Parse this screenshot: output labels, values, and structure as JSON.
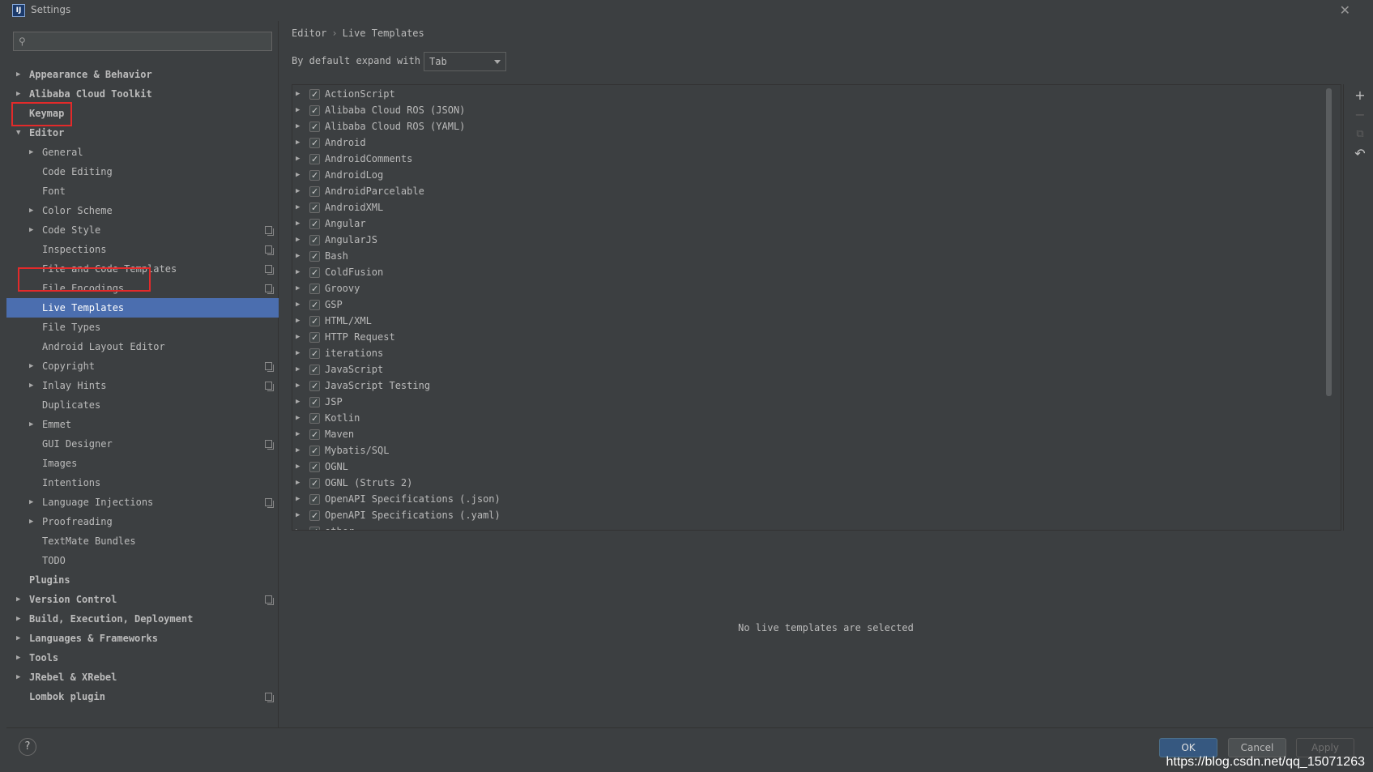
{
  "window": {
    "title": "Settings",
    "app_icon_text": "IJ"
  },
  "search": {
    "placeholder": ""
  },
  "sidebar": {
    "items": [
      {
        "label": "Appearance & Behavior",
        "has_arrow": true,
        "expanded": false,
        "level": 0,
        "bold": true
      },
      {
        "label": "Alibaba Cloud Toolkit",
        "has_arrow": true,
        "expanded": false,
        "level": 0,
        "bold": true
      },
      {
        "label": "Keymap",
        "has_arrow": false,
        "level": 0,
        "bold": true
      },
      {
        "label": "Editor",
        "has_arrow": true,
        "expanded": true,
        "level": 0,
        "bold": true
      },
      {
        "label": "General",
        "has_arrow": true,
        "expanded": false,
        "level": 1
      },
      {
        "label": "Code Editing",
        "has_arrow": false,
        "level": 1
      },
      {
        "label": "Font",
        "has_arrow": false,
        "level": 1
      },
      {
        "label": "Color Scheme",
        "has_arrow": true,
        "expanded": false,
        "level": 1
      },
      {
        "label": "Code Style",
        "has_arrow": true,
        "expanded": false,
        "level": 1,
        "project_icon": true
      },
      {
        "label": "Inspections",
        "has_arrow": false,
        "level": 1,
        "project_icon": true
      },
      {
        "label": "File and Code Templates",
        "has_arrow": false,
        "level": 1,
        "project_icon": true
      },
      {
        "label": "File Encodings",
        "has_arrow": false,
        "level": 1,
        "project_icon": true
      },
      {
        "label": "Live Templates",
        "has_arrow": false,
        "level": 1,
        "selected": true
      },
      {
        "label": "File Types",
        "has_arrow": false,
        "level": 1
      },
      {
        "label": "Android Layout Editor",
        "has_arrow": false,
        "level": 1
      },
      {
        "label": "Copyright",
        "has_arrow": true,
        "expanded": false,
        "level": 1,
        "project_icon": true
      },
      {
        "label": "Inlay Hints",
        "has_arrow": true,
        "expanded": false,
        "level": 1,
        "project_icon": true
      },
      {
        "label": "Duplicates",
        "has_arrow": false,
        "level": 1
      },
      {
        "label": "Emmet",
        "has_arrow": true,
        "expanded": false,
        "level": 1
      },
      {
        "label": "GUI Designer",
        "has_arrow": false,
        "level": 1,
        "project_icon": true
      },
      {
        "label": "Images",
        "has_arrow": false,
        "level": 1
      },
      {
        "label": "Intentions",
        "has_arrow": false,
        "level": 1
      },
      {
        "label": "Language Injections",
        "has_arrow": true,
        "expanded": false,
        "level": 1,
        "project_icon": true
      },
      {
        "label": "Proofreading",
        "has_arrow": true,
        "expanded": false,
        "level": 1
      },
      {
        "label": "TextMate Bundles",
        "has_arrow": false,
        "level": 1
      },
      {
        "label": "TODO",
        "has_arrow": false,
        "level": 1
      },
      {
        "label": "Plugins",
        "has_arrow": false,
        "level": 0,
        "bold": true
      },
      {
        "label": "Version Control",
        "has_arrow": true,
        "expanded": false,
        "level": 0,
        "bold": true,
        "project_icon": true
      },
      {
        "label": "Build, Execution, Deployment",
        "has_arrow": true,
        "expanded": false,
        "level": 0,
        "bold": true
      },
      {
        "label": "Languages & Frameworks",
        "has_arrow": true,
        "expanded": false,
        "level": 0,
        "bold": true
      },
      {
        "label": "Tools",
        "has_arrow": true,
        "expanded": false,
        "level": 0,
        "bold": true
      },
      {
        "label": "JRebel & XRebel",
        "has_arrow": true,
        "expanded": false,
        "level": 0,
        "bold": true
      },
      {
        "label": "Lombok plugin",
        "has_arrow": false,
        "level": 0,
        "bold": true,
        "project_icon": true
      }
    ]
  },
  "breadcrumb": {
    "parent": "Editor",
    "separator": "›",
    "current": "Live Templates"
  },
  "expand": {
    "label": "By default expand with",
    "value": "Tab"
  },
  "template_groups": [
    "ActionScript",
    "Alibaba Cloud ROS (JSON)",
    "Alibaba Cloud ROS (YAML)",
    "Android",
    "AndroidComments",
    "AndroidLog",
    "AndroidParcelable",
    "AndroidXML",
    "Angular",
    "AngularJS",
    "Bash",
    "ColdFusion",
    "Groovy",
    "GSP",
    "HTML/XML",
    "HTTP Request",
    "iterations",
    "JavaScript",
    "JavaScript Testing",
    "JSP",
    "Kotlin",
    "Maven",
    "Mybatis/SQL",
    "OGNL",
    "OGNL (Struts 2)",
    "OpenAPI Specifications (.json)",
    "OpenAPI Specifications (.yaml)",
    "other"
  ],
  "toolbar": {
    "add": "+",
    "remove": "−",
    "copy": "⧉",
    "restore": "↶"
  },
  "empty_message": "No live templates are selected",
  "buttons": {
    "ok": "OK",
    "cancel": "Cancel",
    "apply": "Apply",
    "help": "?"
  },
  "watermark": "https://blog.csdn.net/qq_15071263",
  "colors": {
    "selection": "#4b6eaf",
    "highlight_box": "#e32a2a",
    "background": "#3c3f41"
  }
}
